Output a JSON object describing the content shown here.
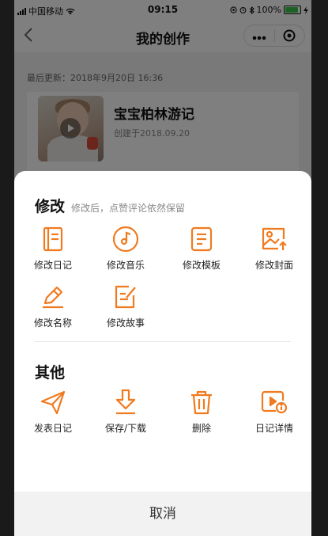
{
  "status_bar": {
    "carrier": "中国移动",
    "time": "09:15",
    "battery": "100%",
    "battery_level": 1.0
  },
  "nav": {
    "back_icon": "chevron-left-icon",
    "title": "我的创作",
    "more_icon": "more-dots-icon",
    "close_icon": "target-circle-icon"
  },
  "page": {
    "last_updated": "最后更新：2018年9月20日 16:36",
    "card": {
      "title": "宝宝柏林游记",
      "date": "创建于2018.09.20"
    }
  },
  "sheet": {
    "modify": {
      "title": "修改",
      "subtitle": "修改后，点赞评论依然保留",
      "items": [
        {
          "label": "修改日记",
          "icon": "book-icon"
        },
        {
          "label": "修改音乐",
          "icon": "music-disc-icon"
        },
        {
          "label": "修改模板",
          "icon": "template-icon"
        },
        {
          "label": "修改封面",
          "icon": "image-upload-icon"
        },
        {
          "label": "修改名称",
          "icon": "pen-icon"
        },
        {
          "label": "修改故事",
          "icon": "edit-note-icon"
        }
      ]
    },
    "other": {
      "title": "其他",
      "items": [
        {
          "label": "发表日记",
          "icon": "send-icon"
        },
        {
          "label": "保存/下载",
          "icon": "download-icon"
        },
        {
          "label": "删除",
          "icon": "trash-icon"
        },
        {
          "label": "日记详情",
          "icon": "video-info-icon"
        }
      ]
    },
    "cancel": "取消"
  },
  "colors": {
    "accent": "#f07a1f",
    "overlay": "rgba(0,0,0,0.5)",
    "battery_green": "#3ac54a"
  }
}
